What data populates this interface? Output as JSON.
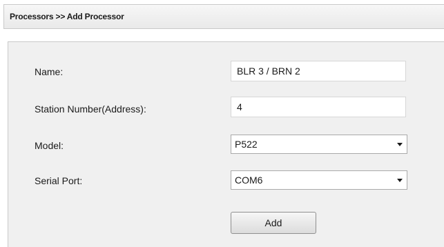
{
  "header": {
    "breadcrumb": "Processors >> Add Processor"
  },
  "form": {
    "name": {
      "label": "Name:",
      "value": "BLR 3 / BRN 2"
    },
    "station_number": {
      "label": "Station Number(Address):",
      "value": "4"
    },
    "model": {
      "label": "Model:",
      "selected": "P522"
    },
    "serial_port": {
      "label": "Serial Port:",
      "selected": "COM6"
    },
    "add_button": {
      "label": "Add"
    }
  },
  "icons": {
    "model_dropdown": "chevron-down-icon",
    "serial_port_dropdown": "chevron-down-icon"
  },
  "colors": {
    "panel_background": "#f0f0f0",
    "header_background": "#ececec",
    "border": "#c9c9c9"
  }
}
